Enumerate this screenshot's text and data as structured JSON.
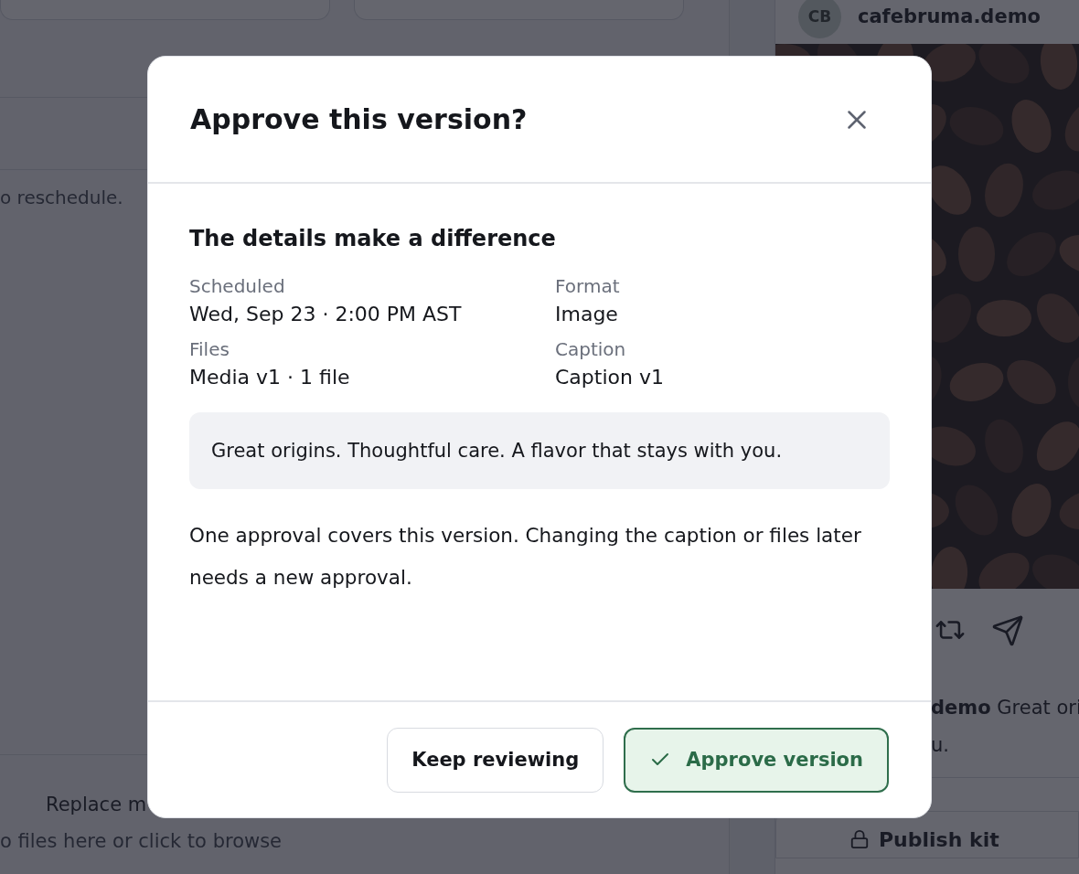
{
  "background": {
    "notice": "o reschedule.",
    "upload_title": "Replace m",
    "upload_hint": "o files here or click to browse",
    "preview": {
      "avatar": "CB",
      "account": "cafebruma.demo",
      "caption_lines": [
        "**demo** Great ori",
        "u."
      ],
      "publish_kit": "Publish kit"
    }
  },
  "dialog": {
    "title": "Approve this version?",
    "subtitle": "The details make a difference",
    "details": [
      {
        "label": "Scheduled",
        "value": "Wed, Sep 23 · 2:00 PM AST"
      },
      {
        "label": "Format",
        "value": "Image"
      },
      {
        "label": "Files",
        "value": "Media v1 · 1 file"
      },
      {
        "label": "Caption",
        "value": "Caption v1"
      }
    ],
    "caption_text": "Great origins. Thoughtful care. A flavor that stays with you.",
    "note": "One approval covers this version. Changing the caption or files later needs a new approval.",
    "buttons": [
      {
        "label": "Keep reviewing",
        "kind": "secondary"
      },
      {
        "label": "Approve version",
        "kind": "primary"
      }
    ]
  }
}
